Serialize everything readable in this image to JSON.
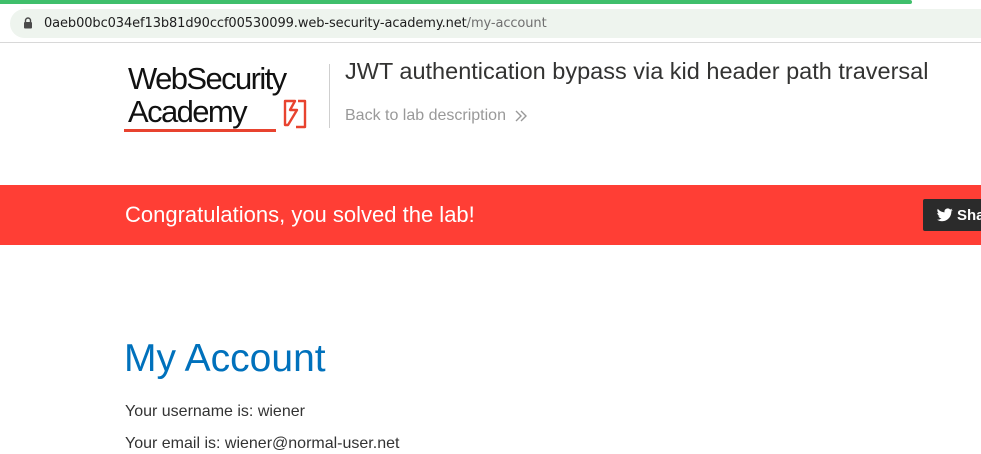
{
  "browser": {
    "url_host": "0aeb00bc034ef13b81d90ccf00530099.web-security-academy.net",
    "url_path": "/my-account",
    "lock_icon": "lock-icon",
    "progress_color": "#3fbf6b"
  },
  "header": {
    "logo_line1": "WebSecurity",
    "logo_line2": "Academy",
    "logo_accent_color": "#e8432f",
    "lab_title": "JWT authentication bypass via kid header path traversal",
    "back_link_label": "Back to lab description",
    "back_link_icon": "double-chevron-right-icon"
  },
  "banner": {
    "message": "Congratulations, you solved the lab!",
    "share_label": "Sha",
    "share_icon": "twitter-icon",
    "color": "#ff3e35"
  },
  "account": {
    "heading": "My Account",
    "username_line": "Your username is: wiener",
    "email_line": "Your email is: wiener@normal-user.net",
    "heading_color": "#0071bc"
  }
}
